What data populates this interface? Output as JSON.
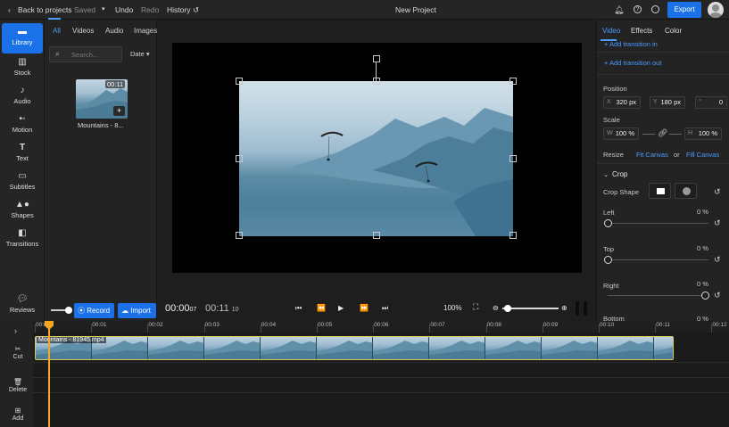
{
  "topbar": {
    "back_label": "Back to projects",
    "saved_label": "Saved",
    "undo_label": "Undo",
    "redo_label": "Redo",
    "history_label": "History",
    "project_title": "New Project",
    "export_label": "Export"
  },
  "leftnav": {
    "items": [
      {
        "label": "Library",
        "icon": "folder-icon"
      },
      {
        "label": "Stock",
        "icon": "stock-icon"
      },
      {
        "label": "Audio",
        "icon": "music-note-icon"
      },
      {
        "label": "Motion",
        "icon": "motion-icon"
      },
      {
        "label": "Text",
        "icon": "text-icon"
      },
      {
        "label": "Subtitles",
        "icon": "subtitles-icon"
      },
      {
        "label": "Shapes",
        "icon": "shapes-icon"
      },
      {
        "label": "Transitions",
        "icon": "transitions-icon"
      },
      {
        "label": "Reviews",
        "icon": "reviews-icon"
      }
    ]
  },
  "library": {
    "tabs": [
      "All",
      "Videos",
      "Audio",
      "Images"
    ],
    "search_placeholder": "Search...",
    "sort_label": "Date",
    "media": [
      {
        "name": "Mountains - 8...",
        "duration": "00:11"
      }
    ],
    "record_label": "Record",
    "import_label": "Import"
  },
  "playback": {
    "current_time": "00:00",
    "current_frames": "07",
    "total_time": "00:11",
    "total_frames": "10",
    "zoom": "100%",
    "timeline_zoom_fraction": 0.1
  },
  "rightpanel": {
    "tabs": [
      "Video",
      "Effects",
      "Color"
    ],
    "add_transition_in": "+ Add transition in",
    "add_transition_out": "+ Add transition out",
    "position_label": "Position",
    "position_x": "320 px",
    "position_y": "180 px",
    "rotation": "0",
    "scale_label": "Scale",
    "scale_w": "100 %",
    "scale_h": "100 %",
    "resize_label": "Resize",
    "fit_canvas": "Fit Canvas",
    "or_label": "or",
    "fill_canvas": "Fill Canvas",
    "crop_label": "Crop",
    "crop_shape_label": "Crop Shape",
    "crop_sides": [
      {
        "label": "Left",
        "value": "0 %"
      },
      {
        "label": "Top",
        "value": "0 %"
      },
      {
        "label": "Right",
        "value": "0 %"
      },
      {
        "label": "Bottom",
        "value": "0 %"
      }
    ]
  },
  "timeline": {
    "tools": [
      "Cut",
      "Delete",
      "Add"
    ],
    "ruler": [
      "00:00",
      "00:01",
      "00:02",
      "00:03",
      "00:04",
      "00:05",
      "00:06",
      "00:07",
      "00:08",
      "00:09",
      "00:10",
      "00:11",
      "00:12"
    ],
    "clip_name": "Mountains - 81945.mp4"
  }
}
